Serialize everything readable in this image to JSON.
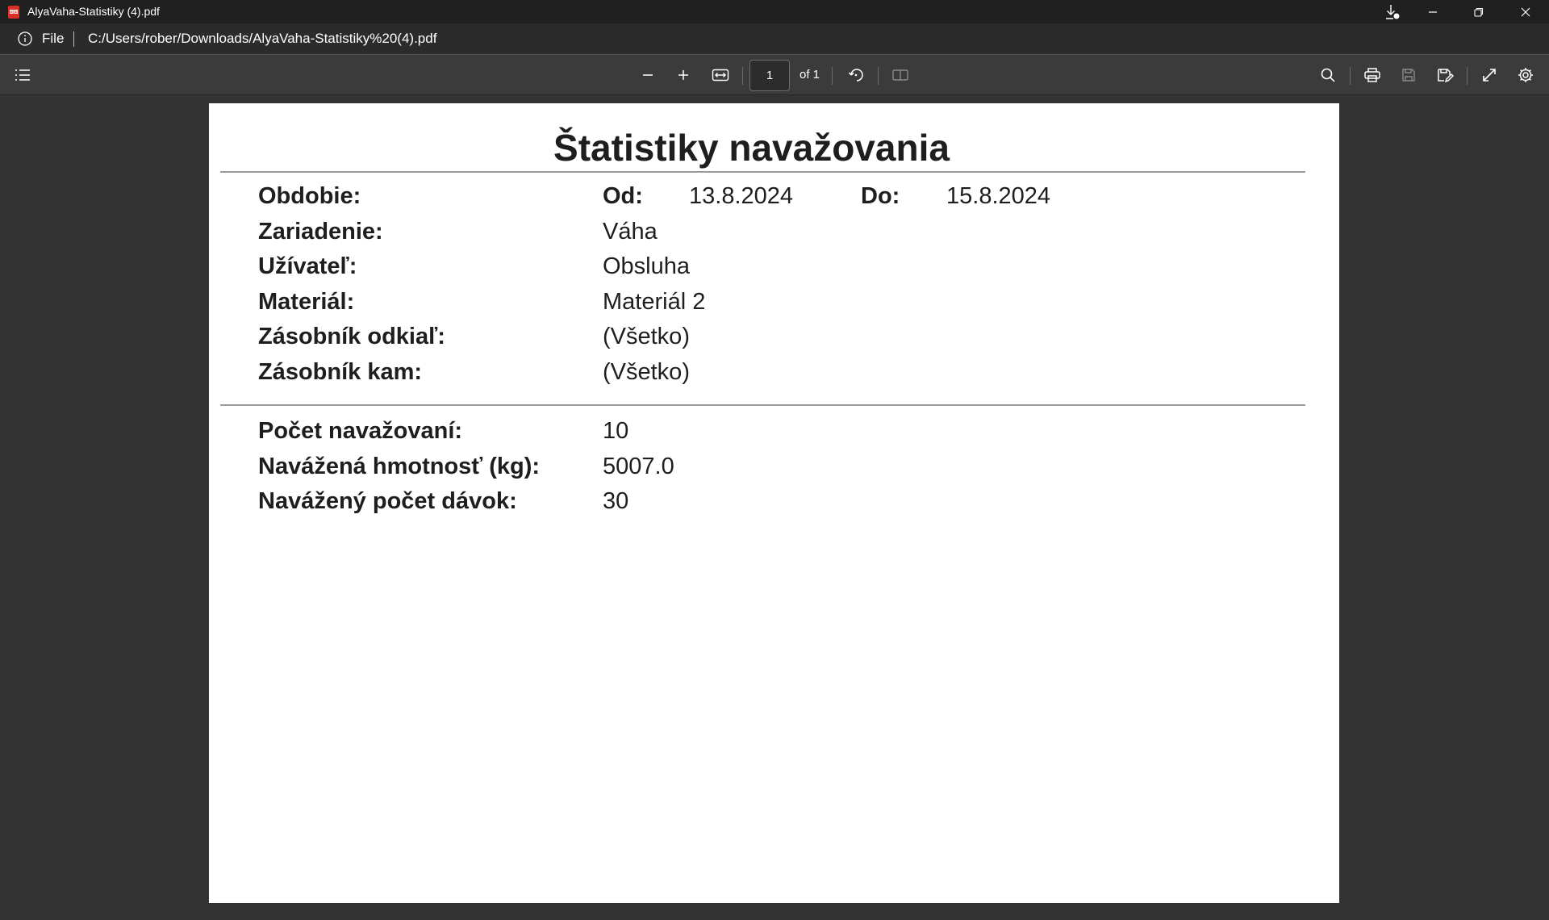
{
  "window": {
    "title": "AlyaVaha-Statistiky (4).pdf"
  },
  "address": {
    "scheme": "File",
    "url": "C:/Users/rober/Downloads/AlyaVaha-Statistiky%20(4).pdf"
  },
  "toolbar": {
    "page_number": "1",
    "page_of": "of 1"
  },
  "document": {
    "title": "Štatistiky navažovania",
    "period": {
      "label": "Obdobie:",
      "from_label": "Od:",
      "from_value": "13.8.2024",
      "to_label": "Do:",
      "to_value": "15.8.2024"
    },
    "filters": [
      {
        "label": "Zariadenie:",
        "value": "Váha"
      },
      {
        "label": "Užívateľ:",
        "value": "Obsluha"
      },
      {
        "label": "Materiál:",
        "value": "Materiál 2"
      },
      {
        "label": "Zásobník odkiaľ:",
        "value": "(Všetko)"
      },
      {
        "label": "Zásobník kam:",
        "value": "(Všetko)"
      }
    ],
    "stats": [
      {
        "label": "Počet navažovaní:",
        "value": "10"
      },
      {
        "label": "Navážená hmotnosť (kg):",
        "value": "5007.0"
      },
      {
        "label": "Navážený počet dávok:",
        "value": "30"
      }
    ]
  },
  "colors": {
    "titlebar": "#202020",
    "addressbar": "#2b2b2b",
    "toolbar": "#3b3b3b",
    "viewer_background": "#333333",
    "page": "#ffffff",
    "pdf_icon": "#d93025"
  },
  "icons": [
    "pdf-file-icon",
    "downloads-icon",
    "minimize-icon",
    "restore-icon",
    "close-icon",
    "info-icon",
    "outline-icon",
    "zoom-out-icon",
    "zoom-in-icon",
    "fit-page-icon",
    "rotate-icon",
    "two-page-icon",
    "search-icon",
    "print-icon",
    "save-icon",
    "save-as-icon",
    "fullscreen-icon",
    "settings-icon"
  ]
}
